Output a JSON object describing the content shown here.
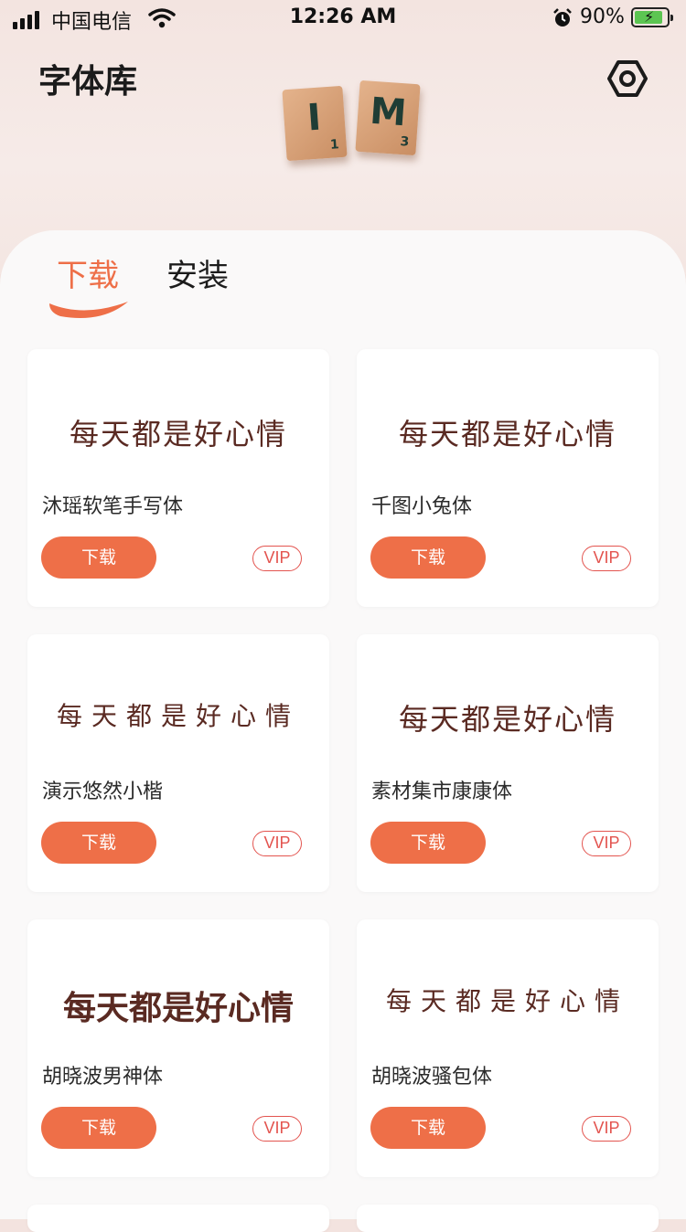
{
  "status_bar": {
    "carrier": "中国电信",
    "time": "12:26 AM",
    "battery": "90%",
    "battery_level": 0.9
  },
  "header": {
    "title": "字体库",
    "settings_icon": "settings-hexagon-icon",
    "tiles": [
      {
        "letter": "I",
        "score": "1"
      },
      {
        "letter": "M",
        "score": "3"
      }
    ]
  },
  "tabs": [
    {
      "label": "下载",
      "active": true
    },
    {
      "label": "安装",
      "active": false
    }
  ],
  "colors": {
    "accent": "#ee6f48",
    "vip": "#e3544f",
    "preview_text": "#5a2a22"
  },
  "fonts": [
    {
      "preview": "每天都是好心情",
      "name": "沐瑶软笔手写体",
      "button": "下载",
      "badge": "VIP"
    },
    {
      "preview": "每天都是好心情",
      "name": "千图小兔体",
      "button": "下载",
      "badge": "VIP"
    },
    {
      "preview": "每天都是好心情",
      "name": "演示悠然小楷",
      "button": "下载",
      "badge": "VIP"
    },
    {
      "preview": "每天都是好心情",
      "name": "素材集市康康体",
      "button": "下载",
      "badge": "VIP"
    },
    {
      "preview": "每天都是好心情",
      "name": "胡晓波男神体",
      "button": "下载",
      "badge": "VIP"
    },
    {
      "preview": "每天都是好心情",
      "name": "胡晓波骚包体",
      "button": "下载",
      "badge": "VIP"
    }
  ]
}
